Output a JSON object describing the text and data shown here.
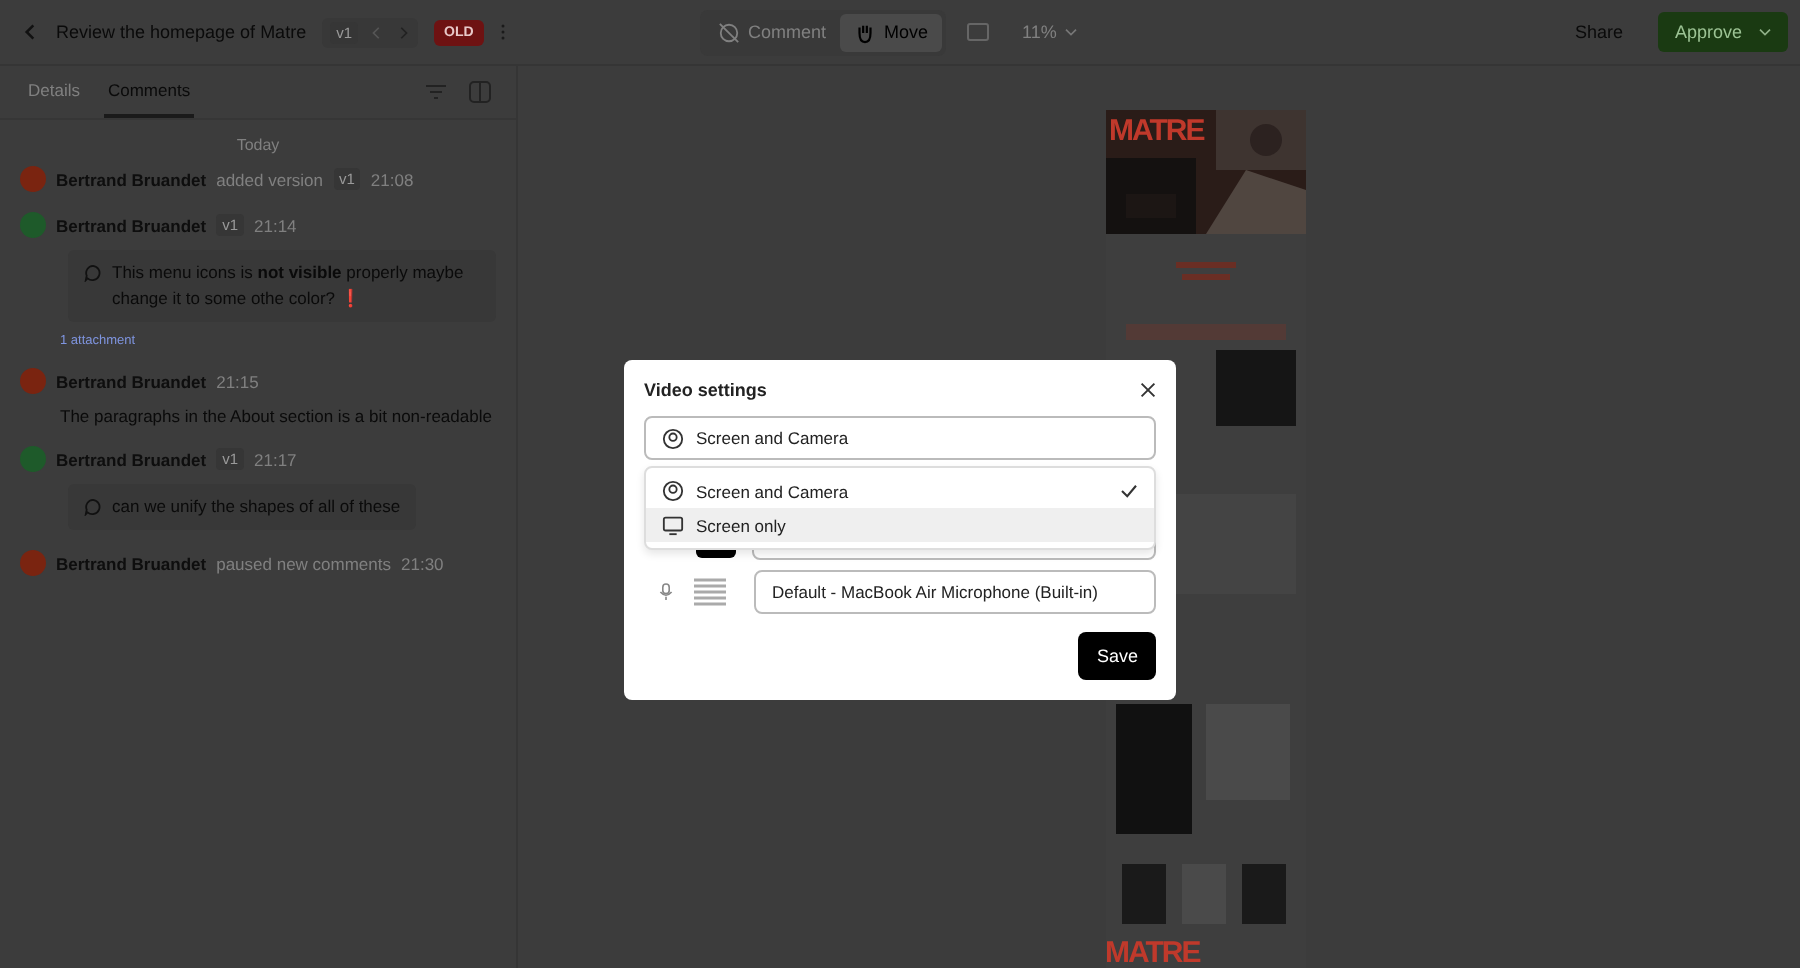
{
  "header": {
    "title": "Review the homepage of Matre",
    "version": "v1",
    "version_status": "OLD"
  },
  "toolbar": {
    "tools": [
      {
        "label": "Comment",
        "selected": false
      },
      {
        "label": "Move",
        "selected": true
      }
    ],
    "zoom": "11%",
    "share": "Share",
    "approve": "Approve"
  },
  "tabs": [
    {
      "label": "Details",
      "selected": false
    },
    {
      "label": "Comments",
      "selected": true
    }
  ],
  "day_label": "Today",
  "activity": [
    {
      "kind": "event",
      "author": "Bertrand Bruandet",
      "action": "added version",
      "version": "v1",
      "time": "21:08",
      "color": "#7a2410"
    },
    {
      "kind": "bubble",
      "author": "Bertrand Bruandet",
      "version": "v1",
      "time": "21:14",
      "color": "#1e5a2a",
      "text": "This menu icons is **not visible** properly maybe change it to some othe color? ❗",
      "attachment": "1 attachment"
    },
    {
      "kind": "comment",
      "author": "Bertrand Bruandet",
      "time": "21:15",
      "color": "#7a2410",
      "text": "The paragraphs in the About section is a bit non-readable"
    },
    {
      "kind": "bubble",
      "author": "Bertrand Bruandet",
      "version": "v1",
      "time": "21:17",
      "color": "#1e5a2a",
      "text": "can we unify the shapes of all of these"
    },
    {
      "kind": "event",
      "author": "Bertrand Bruandet",
      "action": "paused new comments",
      "time": "21:30",
      "color": "#7a2410"
    }
  ],
  "preview": {
    "logos": [
      "MATRE",
      "MATRE"
    ]
  },
  "modal": {
    "title": "Video settings",
    "mode": {
      "label": "Screen and Camera",
      "kind": "camera"
    },
    "options": [
      {
        "label": "Screen and Camera",
        "kind": "camera",
        "selected": true,
        "highlighted": false
      },
      {
        "label": "Screen only",
        "kind": "screen",
        "selected": false,
        "highlighted": true
      }
    ],
    "microphone": "Default - MacBook Air Microphone (Built-in)",
    "save": "Save"
  }
}
